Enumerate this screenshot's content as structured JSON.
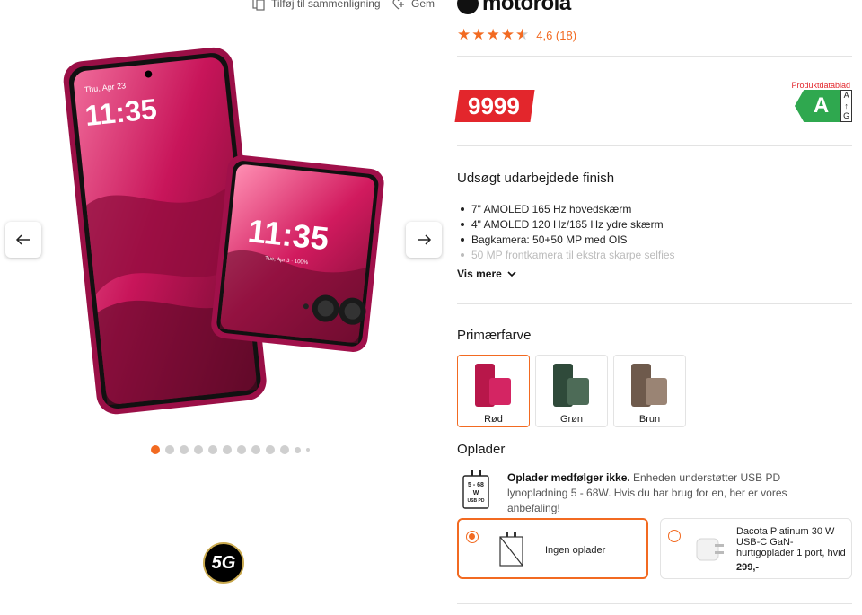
{
  "top_actions": {
    "compare": "Tilføj til sammenligning",
    "save": "Gem"
  },
  "brand": {
    "name": "motorola"
  },
  "rating": {
    "value_text": "4,6 (18)",
    "stars": 4.6
  },
  "price": {
    "amount": "9999",
    "energy_title": "Produktdatablad",
    "energy_class": "A",
    "scale_top": "A",
    "scale_bottom": "G"
  },
  "features": {
    "title": "Udsøgt udarbejdede finish",
    "items": [
      "7\" AMOLED 165 Hz hovedskærm",
      "4\" AMOLED 120 Hz/165 Hz ydre skærm",
      "Bagkamera: 50+50 MP med OIS",
      "50 MP frontkamera til ekstra skarpe selfies"
    ],
    "more": "Vis mere"
  },
  "color": {
    "title": "Primærfarve",
    "options": [
      {
        "label": "Rød",
        "swatch": "#b8174a"
      },
      {
        "label": "Grøn",
        "swatch": "#2f4a3a"
      },
      {
        "label": "Brun",
        "swatch": "#6e5a4c"
      }
    ]
  },
  "charger": {
    "title": "Oplader",
    "icon_top": "5 - 68",
    "icon_mid": "W",
    "icon_bottom": "USB PD",
    "info_bold": "Oplader medfølger ikke.",
    "info_text": " Enheden understøtter USB PD lynopladning 5 - 68W. Hvis du har brug for en, her er vores anbefaling!",
    "none_label": "Ingen oplader",
    "rec_name": "Dacota Platinum 30 W USB-C GaN-hurtigoplader 1 port, hvid",
    "rec_price": "299,-"
  },
  "gallery": {
    "badge": "5G",
    "dot_count": 12,
    "active_index": 0
  },
  "colors_theme": {
    "accent": "#f26a21",
    "price_bg": "#e3262c",
    "energy": "#2fa84f"
  }
}
